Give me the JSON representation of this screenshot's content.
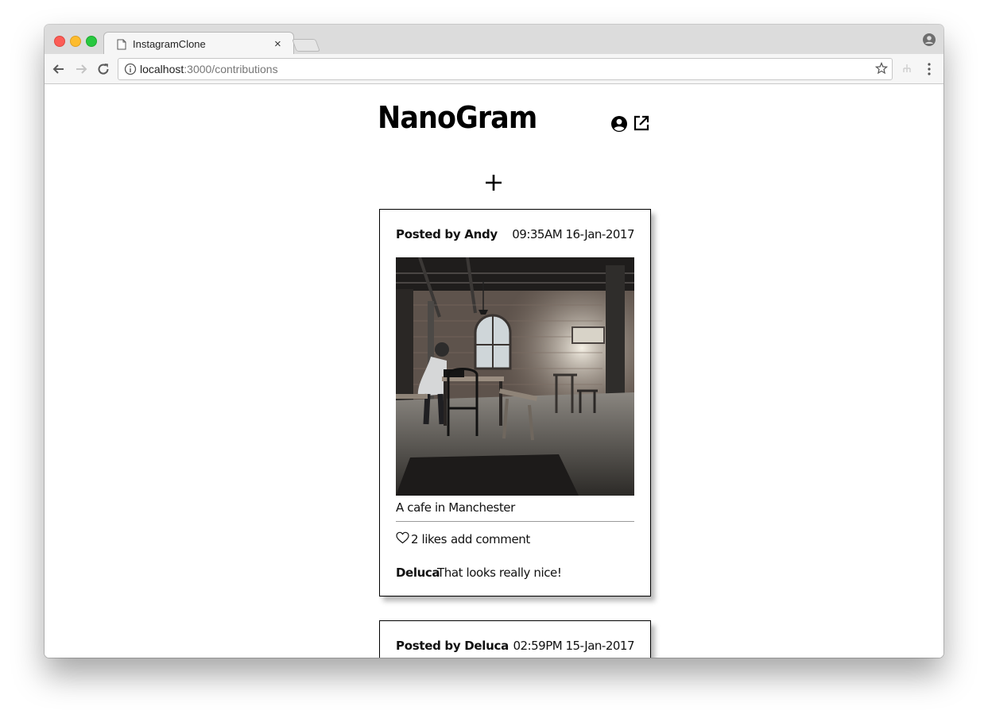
{
  "browser": {
    "tab_title": "InstagramClone",
    "tab_close": "×",
    "url_host": "localhost",
    "url_path": ":3000/contributions"
  },
  "app": {
    "brand": "NanoGram",
    "add_symbol": "+"
  },
  "posts": [
    {
      "posted_by": "Posted by Andy",
      "timestamp": "09:35AM 16-Jan-2017",
      "caption": "A cafe in Manchester",
      "likes": "2 likes",
      "add_comment": "add comment",
      "comments": [
        {
          "author": "Deluca",
          "text": "That looks really nice!"
        }
      ]
    },
    {
      "posted_by": "Posted by Deluca",
      "timestamp": "02:59PM 15-Jan-2017"
    }
  ]
}
